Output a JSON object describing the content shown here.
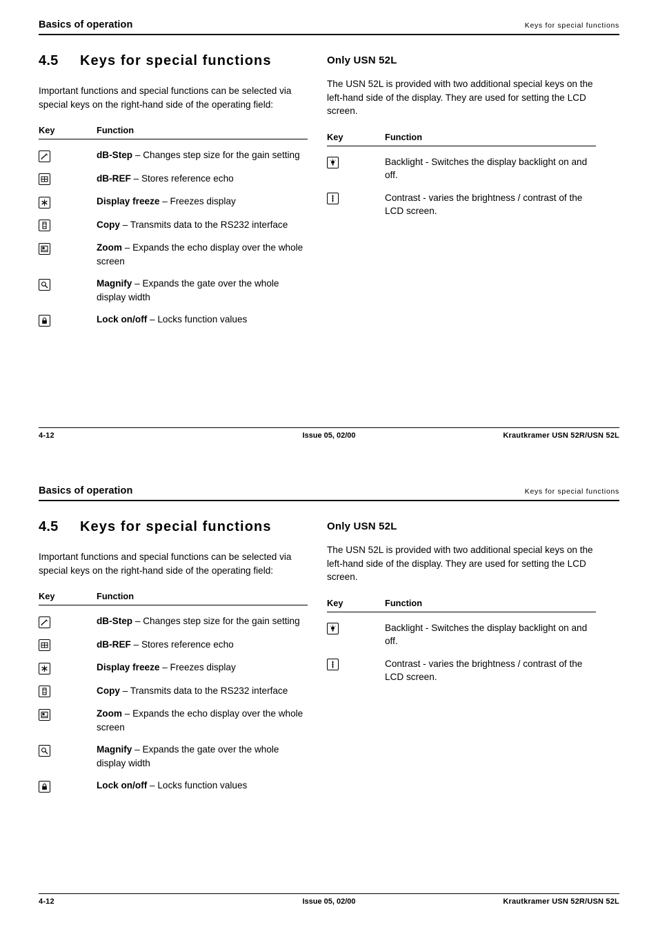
{
  "header": {
    "left": "Basics of operation",
    "right": "Keys for special functions"
  },
  "section": {
    "number": "4.5",
    "title": "Keys for special functions",
    "intro": "Important functions and special functions can be selected via special keys on the right-hand side of the operating field:"
  },
  "table_left": {
    "col_key": "Key",
    "col_function": "Function",
    "rows": [
      {
        "icon": "db-step-key-icon",
        "name": "dB-Step",
        "desc": " – Changes step size for the gain setting"
      },
      {
        "icon": "db-ref-key-icon",
        "name": "dB-REF",
        "desc": " – Stores reference echo"
      },
      {
        "icon": "display-freeze-key-icon",
        "name": "Display freeze",
        "desc": " – Freezes display"
      },
      {
        "icon": "copy-key-icon",
        "name": "Copy",
        "desc": " – Transmits data to the RS232 interface"
      },
      {
        "icon": "zoom-key-icon",
        "name": "Zoom",
        "desc": " – Expands the echo display over the whole screen"
      },
      {
        "icon": "magnify-key-icon",
        "name": "Magnify",
        "desc": " – Expands the gate over the whole display width"
      },
      {
        "icon": "lock-key-icon",
        "name": "Lock on/off",
        "desc": " – Locks function values"
      }
    ]
  },
  "right_column": {
    "heading": "Only USN 52L",
    "intro": "The USN 52L is provided with two additional special keys on the left-hand side of the display. They are used for setting the LCD screen.",
    "col_key": "Key",
    "col_function": "Function",
    "rows": [
      {
        "icon": "backlight-key-icon",
        "text": "Backlight - Switches the display backlight on and off."
      },
      {
        "icon": "contrast-key-icon",
        "text": "Contrast - varies the brightness / contrast of the LCD screen."
      }
    ]
  },
  "footer": {
    "page": "4-12",
    "issue": "Issue 05, 02/00",
    "product": "Krautkramer USN 52R/USN 52L"
  }
}
